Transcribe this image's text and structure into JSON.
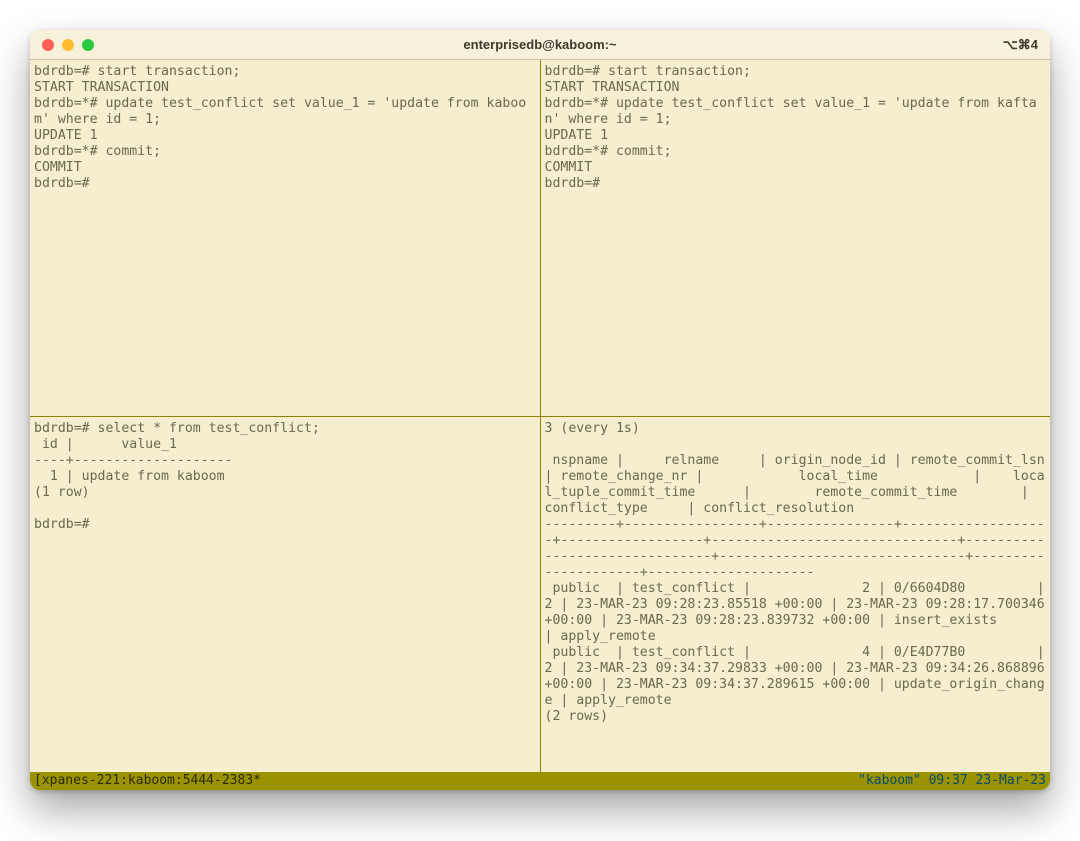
{
  "window": {
    "title": "enterprisedb@kaboom:~",
    "shortcut": "⌥⌘4"
  },
  "panes": {
    "top_left": "bdrdb=# start transaction;\nSTART TRANSACTION\nbdrdb=*# update test_conflict set value_1 = 'update from kaboom' where id = 1;\nUPDATE 1\nbdrdb=*# commit;\nCOMMIT\nbdrdb=#",
    "top_right": "bdrdb=# start transaction;\nSTART TRANSACTION\nbdrdb=*# update test_conflict set value_1 = 'update from kaftan' where id = 1;\nUPDATE 1\nbdrdb=*# commit;\nCOMMIT\nbdrdb=#",
    "bottom_left": "bdrdb=# select * from test_conflict;\n id |      value_1\n----+--------------------\n  1 | update from kaboom\n(1 row)\n\nbdrdb=#",
    "bottom_right": "3 (every 1s)\n\n nspname |     relname     | origin_node_id | remote_commit_lsn | remote_change_nr |            local_time            |    local_tuple_commit_time      |        remote_commit_time        |    conflict_type     | conflict_resolution\n---------+-----------------+----------------+-------------------+------------------+-------------------------------+-------------------------------+-------------------------------+---------------------+---------------------\n public  | test_conflict |              2 | 0/6604D80         |                2 | 23-MAR-23 09:28:23.85518 +00:00 | 23-MAR-23 09:28:17.700346 +00:00 | 23-MAR-23 09:28:23.839732 +00:00 | insert_exists        | apply_remote\n public  | test_conflict |              4 | 0/E4D77B0         |                2 | 23-MAR-23 09:34:37.29833 +00:00 | 23-MAR-23 09:34:26.868896 +00:00 | 23-MAR-23 09:34:37.289615 +00:00 | update_origin_change | apply_remote\n(2 rows)"
  },
  "statusbar": {
    "left": "[xpanes-221:kaboom:5444-2383*",
    "right": "\"kaboom\" 09:37 23-Mar-23"
  },
  "colors": {
    "bg": "#f5eecf",
    "text": "#6c6750",
    "divider": "#8c8403",
    "statusbar": "#9b9200"
  }
}
